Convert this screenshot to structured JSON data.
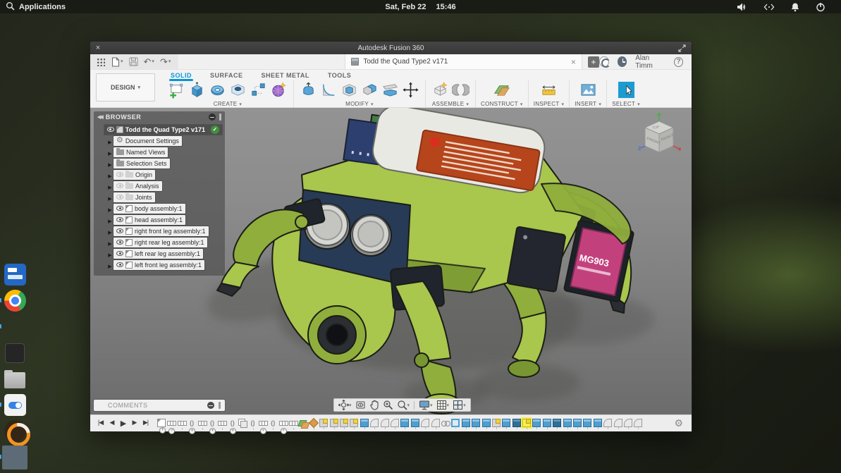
{
  "desktop": {
    "topbar": {
      "applications_label": "Applications",
      "date": "Sat, Feb 22",
      "time": "15:46",
      "tray_icons": [
        "volume-icon",
        "network-icon",
        "notifications-icon",
        "power-icon"
      ]
    },
    "dock_items": [
      {
        "cls": "remmina",
        "name": "dock-item-remmina",
        "run": ""
      },
      {
        "cls": "chrome",
        "name": "dock-item-chrome",
        "run": "running"
      },
      {
        "cls": "vscode",
        "name": "dock-item-vscode",
        "run": "running"
      },
      {
        "cls": "terminal",
        "name": "dock-item-terminal",
        "run": ""
      },
      {
        "cls": "home",
        "name": "dock-item-home-folder",
        "run": ""
      },
      {
        "cls": "tweaks",
        "name": "dock-item-tweaks",
        "run": "running"
      },
      {
        "cls": "ubuntu-mate",
        "name": "dock-item-ubuntu-mate",
        "run": ""
      },
      {
        "cls": "settings",
        "name": "dock-item-settings",
        "run": "running"
      }
    ],
    "dock_terminal_glyph": "$_",
    "dock_home_glyph": "⌂",
    "dock_settings_glyph": "⚙"
  },
  "window": {
    "title": "Autodesk Fusion 360",
    "close_glyph": "×",
    "quick_access_icons": [
      "app-grid-icon",
      "file-menu-icon",
      "save-icon",
      "undo-icon",
      "redo-icon"
    ],
    "doc_tab": {
      "title": "Todd the Quad Type2 v171",
      "close_glyph": "×",
      "new_tab_glyph": "+"
    },
    "account": {
      "user": "Alan Timm",
      "help_glyph": "?"
    },
    "ribbon": {
      "design_label": "DESIGN",
      "tabs": [
        {
          "label": "SOLID",
          "state": "active",
          "name": "tab-solid"
        },
        {
          "label": "SURFACE",
          "state": "",
          "name": "tab-surface"
        },
        {
          "label": "SHEET METAL",
          "state": "",
          "name": "tab-sheet-metal"
        },
        {
          "label": "TOOLS",
          "state": "",
          "name": "tab-tools"
        }
      ],
      "groups": [
        {
          "label": "CREATE"
        },
        {
          "label": "MODIFY"
        },
        {
          "label": "ASSEMBLE"
        },
        {
          "label": "CONSTRUCT"
        },
        {
          "label": "INSPECT"
        },
        {
          "label": "INSERT"
        },
        {
          "label": "SELECT"
        }
      ],
      "create_icons": [
        "create-sketch-icon",
        "extrude-icon",
        "revolve-icon",
        "hole-icon",
        "pattern-icon",
        "create-form-icon"
      ],
      "modify_icons": [
        "press-pull-icon",
        "fillet-icon",
        "shell-icon",
        "combine-icon",
        "split-icon",
        "move-icon"
      ],
      "assemble_icons": [
        "new-component-icon",
        "joint-icon"
      ],
      "construct_icons": [
        "construction-plane-icon"
      ],
      "inspect_icons": [
        "measure-icon"
      ],
      "insert_icons": [
        "insert-image-icon"
      ],
      "select_icons": [
        "select-icon"
      ]
    },
    "browser": {
      "header": "BROWSER",
      "items": [
        {
          "kind": "root",
          "arrow": "",
          "eye": "eye-on",
          "icon": "ic-comp",
          "tone": "",
          "label": "Todd the Quad Type2 v171",
          "check": "check-on"
        },
        {
          "kind": "child",
          "arrow": "arr",
          "eye": "eye-none",
          "icon": "ic-gear",
          "tone": "",
          "label": "Document Settings",
          "check": ""
        },
        {
          "kind": "child",
          "arrow": "arr",
          "eye": "eye-none",
          "icon": "ic-folder",
          "tone": "",
          "label": "Named Views",
          "check": ""
        },
        {
          "kind": "child",
          "arrow": "arr",
          "eye": "eye-none",
          "icon": "ic-folder",
          "tone": "",
          "label": "Selection Sets",
          "check": ""
        },
        {
          "kind": "child",
          "arrow": "arr",
          "eye": "eye-dim",
          "icon": "ic-folder",
          "tone": "dim",
          "label": "Origin",
          "check": ""
        },
        {
          "kind": "child",
          "arrow": "arr",
          "eye": "eye-dim",
          "icon": "ic-folder",
          "tone": "dim",
          "label": "Analysis",
          "check": ""
        },
        {
          "kind": "child",
          "arrow": "arr",
          "eye": "eye-dim",
          "icon": "ic-folder",
          "tone": "dim",
          "label": "Joints",
          "check": ""
        },
        {
          "kind": "child",
          "arrow": "arr",
          "eye": "eye-on",
          "icon": "ic-comp",
          "tone": "",
          "label": "body assembly:1",
          "check": ""
        },
        {
          "kind": "child",
          "arrow": "arr",
          "eye": "eye-on",
          "icon": "ic-comp",
          "tone": "",
          "label": "head assembly:1",
          "check": ""
        },
        {
          "kind": "child",
          "arrow": "arr",
          "eye": "eye-on",
          "icon": "ic-comp",
          "tone": "",
          "label": "right front leg assembly:1",
          "check": ""
        },
        {
          "kind": "child",
          "arrow": "arr",
          "eye": "eye-on",
          "icon": "ic-comp",
          "tone": "",
          "label": "right rear leg assembly:1",
          "check": ""
        },
        {
          "kind": "child",
          "arrow": "arr",
          "eye": "eye-on",
          "icon": "ic-comp",
          "tone": "",
          "label": "left rear leg assembly:1",
          "check": ""
        },
        {
          "kind": "child",
          "arrow": "arr",
          "eye": "eye-on",
          "icon": "ic-comp",
          "tone": "",
          "label": "left front leg assembly:1",
          "check": ""
        }
      ]
    },
    "viewcube": {
      "top": "TOP",
      "front": "FRONT",
      "right": "RIGHT",
      "axis_z": "Z"
    },
    "comments": {
      "label": "COMMENTS"
    },
    "nav_icons": [
      "orbit-icon",
      "look-at-icon",
      "pan-icon",
      "zoom-icon",
      "zoom-window-icon",
      "display-settings-icon",
      "grid-display-icon",
      "viewports-icon"
    ],
    "timeline": {
      "playback": [
        "go-to-start",
        "step-back",
        "play",
        "step-forward",
        "go-to-end"
      ],
      "items": [
        {
          "t": "component",
          "g": "grouped"
        },
        {
          "t": "dots",
          "g": "grouped"
        },
        {
          "t": "dots",
          "g": ""
        },
        {
          "t": "joint",
          "g": "grouped"
        },
        {
          "t": "dots",
          "g": ""
        },
        {
          "t": "joint",
          "g": "grouped"
        },
        {
          "t": "dots",
          "g": ""
        },
        {
          "t": "joint",
          "g": "grouped"
        },
        {
          "t": "instance",
          "g": ""
        },
        {
          "t": "joint",
          "g": ""
        },
        {
          "t": "dots",
          "g": "grouped"
        },
        {
          "t": "joint",
          "g": ""
        },
        {
          "t": "dots",
          "g": "grouped"
        },
        {
          "t": "dots",
          "g": ""
        },
        {
          "t": "plane",
          "g": ""
        },
        {
          "t": "ground",
          "g": ""
        },
        {
          "t": "sketch",
          "g": ""
        },
        {
          "t": "sketch",
          "g": ""
        },
        {
          "t": "sketch",
          "g": ""
        },
        {
          "t": "sketch",
          "g": ""
        },
        {
          "t": "extrude",
          "g": ""
        },
        {
          "t": "fillet",
          "g": ""
        },
        {
          "t": "fillet",
          "g": ""
        },
        {
          "t": "fillet",
          "g": ""
        },
        {
          "t": "extrude",
          "g": ""
        },
        {
          "t": "extrude",
          "g": ""
        },
        {
          "t": "fillet",
          "g": ""
        },
        {
          "t": "fillet",
          "g": ""
        },
        {
          "t": "link",
          "g": ""
        },
        {
          "t": "boxsel",
          "g": ""
        },
        {
          "t": "extrude",
          "g": ""
        },
        {
          "t": "extrude",
          "g": ""
        },
        {
          "t": "extrude",
          "g": ""
        },
        {
          "t": "sketch",
          "g": ""
        },
        {
          "t": "extrude",
          "g": ""
        },
        {
          "t": "extrudedark",
          "g": ""
        },
        {
          "t": "sketchactive",
          "g": ""
        },
        {
          "t": "extrude",
          "g": ""
        },
        {
          "t": "extrude",
          "g": ""
        },
        {
          "t": "extrudedark",
          "g": ""
        },
        {
          "t": "extrude",
          "g": ""
        },
        {
          "t": "extrude",
          "g": ""
        },
        {
          "t": "extrude",
          "g": ""
        },
        {
          "t": "extrude",
          "g": ""
        },
        {
          "t": "fillet",
          "g": ""
        },
        {
          "t": "fillet",
          "g": ""
        },
        {
          "t": "fillet",
          "g": ""
        },
        {
          "t": "fillet",
          "g": ""
        }
      ]
    },
    "model": {
      "servo_label": "MG903",
      "description": "green quadruped robot 3d model"
    }
  },
  "colors": {
    "accent_blue": "#0696d7",
    "select_blue": "#1d9bd1",
    "robot_green": "#a9c64d",
    "servo_pink": "#c2417d",
    "timeline_highlight": "#f7ef56",
    "viewport_gray": "#8c8c8c"
  }
}
